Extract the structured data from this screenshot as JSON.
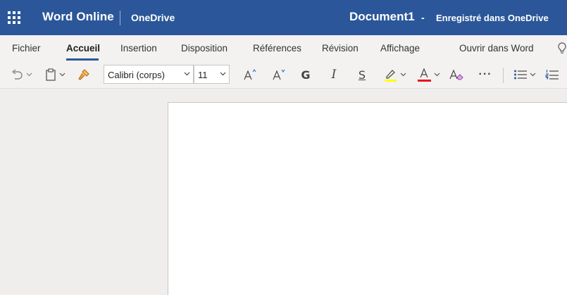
{
  "header": {
    "app_name": "Word Online",
    "service": "OneDrive",
    "doc_title": "Document1",
    "separator": "-",
    "save_status": "Enregistré dans OneDrive"
  },
  "ribbon": {
    "tabs": [
      {
        "label": "Fichier"
      },
      {
        "label": "Accueil",
        "active": true
      },
      {
        "label": "Insertion"
      },
      {
        "label": "Disposition"
      },
      {
        "label": "Références"
      },
      {
        "label": "Révision"
      },
      {
        "label": "Affichage"
      },
      {
        "label": "Ouvrir dans Word"
      }
    ]
  },
  "toolbar": {
    "font_name": "Calibri (corps)",
    "font_size": "11",
    "bold_glyph": "G",
    "italic_glyph": "I",
    "strike_glyph": "S",
    "more_glyph": "···",
    "highlight_color": "#ffff00",
    "font_color": "#e81123"
  },
  "icons": [
    "app-launcher-icon",
    "undo-icon",
    "paste-icon",
    "format-painter-icon",
    "grow-font-icon",
    "shrink-font-icon",
    "highlight-icon",
    "font-color-icon",
    "clear-format-icon",
    "bullets-icon",
    "numbering-icon",
    "lightbulb-icon"
  ],
  "theme": {
    "brand": "#2b579a"
  }
}
